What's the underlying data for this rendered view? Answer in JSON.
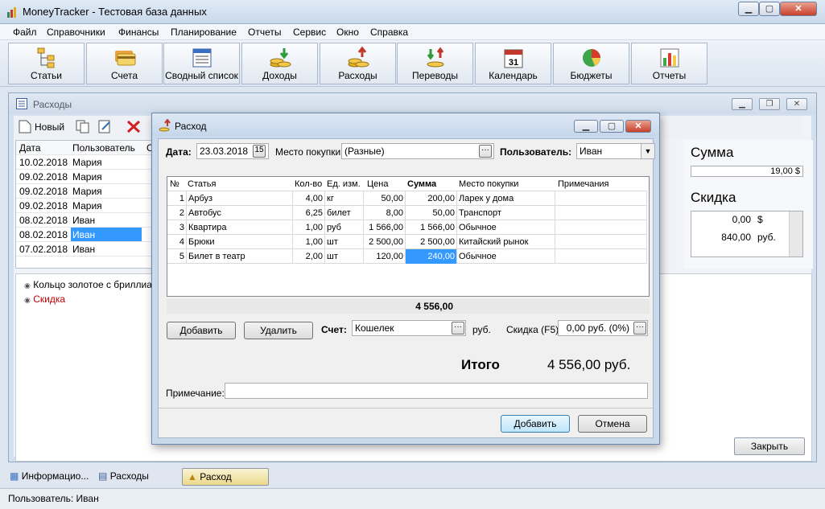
{
  "window": {
    "title": "MoneyTracker - Тестовая база данных"
  },
  "menu": [
    "Файл",
    "Справочники",
    "Финансы",
    "Планирование",
    "Отчеты",
    "Сервис",
    "Окно",
    "Справка"
  ],
  "toolbar": [
    {
      "label": "Статьи",
      "icon": "hierarchy-icon"
    },
    {
      "label": "Счета",
      "icon": "cards-icon"
    },
    {
      "label": "Сводный список",
      "icon": "list-icon"
    },
    {
      "label": "Доходы",
      "icon": "coins-down-icon"
    },
    {
      "label": "Расходы",
      "icon": "coins-up-icon"
    },
    {
      "label": "Переводы",
      "icon": "transfer-icon"
    },
    {
      "label": "Календарь",
      "icon": "calendar-icon"
    },
    {
      "label": "Бюджеты",
      "icon": "pie-chart-icon"
    },
    {
      "label": "Отчеты",
      "icon": "bar-chart-icon"
    }
  ],
  "child": {
    "title": "Расходы",
    "new_label": "Новый",
    "list_headers": [
      "Дата",
      "Пользователь",
      "С"
    ],
    "list_rows": [
      [
        "10.02.2018",
        "Мария"
      ],
      [
        "09.02.2018",
        "Мария"
      ],
      [
        "09.02.2018",
        "Мария"
      ],
      [
        "09.02.2018",
        "Мария"
      ],
      [
        "08.02.2018",
        "Иван"
      ],
      [
        "08.02.2018",
        "Иван"
      ],
      [
        "07.02.2018",
        "Иван"
      ]
    ],
    "info_items": [
      "Кольцо золотое с бриллиант",
      "Скидка"
    ],
    "sum_heading": "Сумма",
    "sum_value": "19,00 $",
    "discount_heading": "Скидка",
    "discount_rows": [
      [
        "0,00",
        "$"
      ],
      [
        "840,00",
        "руб."
      ]
    ],
    "close_label": "Закрыть"
  },
  "dialog": {
    "title": "Расход",
    "date_label": "Дата:",
    "date_value": "23.03.2018",
    "date_button": "15",
    "place_label": "Место покупки:",
    "place_value": "(Разные)",
    "user_label": "Пользователь:",
    "user_value": "Иван",
    "grid_headers": [
      "№",
      "Статья",
      "Кол-во",
      "Ед. изм.",
      "Цена",
      "Сумма",
      "Место покупки",
      "Примечания"
    ],
    "grid_rows": [
      [
        "1",
        "Арбуз",
        "4,00",
        "кг",
        "50,00",
        "200,00",
        "Ларек у дома",
        ""
      ],
      [
        "2",
        "Автобус",
        "6,25",
        "билет",
        "8,00",
        "50,00",
        "Транспорт",
        ""
      ],
      [
        "3",
        "Квартира",
        "1,00",
        "руб",
        "1 566,00",
        "1 566,00",
        "Обычное",
        ""
      ],
      [
        "4",
        "Брюки",
        "1,00",
        "шт",
        "2 500,00",
        "2 500,00",
        "Китайский рынок",
        ""
      ],
      [
        "5",
        "Билет в театр",
        "2,00",
        "шт",
        "120,00",
        "240,00",
        "Обычное",
        ""
      ]
    ],
    "grid_total": "4 556,00",
    "add_row_label": "Добавить",
    "delete_row_label": "Удалить",
    "account_label": "Счет:",
    "account_value": "Кошелек",
    "account_currency": "руб.",
    "discount_label": "Скидка (F5):",
    "discount_value": "0,00 руб. (0%)",
    "total_label": "Итого",
    "total_value": "4 556,00 руб.",
    "note_label": "Примечание:",
    "note_value": "",
    "ok_label": "Добавить",
    "cancel_label": "Отмена"
  },
  "tabs": [
    {
      "label": "Информацио...",
      "icon": "grid-icon"
    },
    {
      "label": "Расходы",
      "icon": "list-icon"
    },
    {
      "label": "Расход",
      "icon": "coins-up-icon"
    }
  ],
  "status": {
    "user": "Пользователь: Иван"
  }
}
